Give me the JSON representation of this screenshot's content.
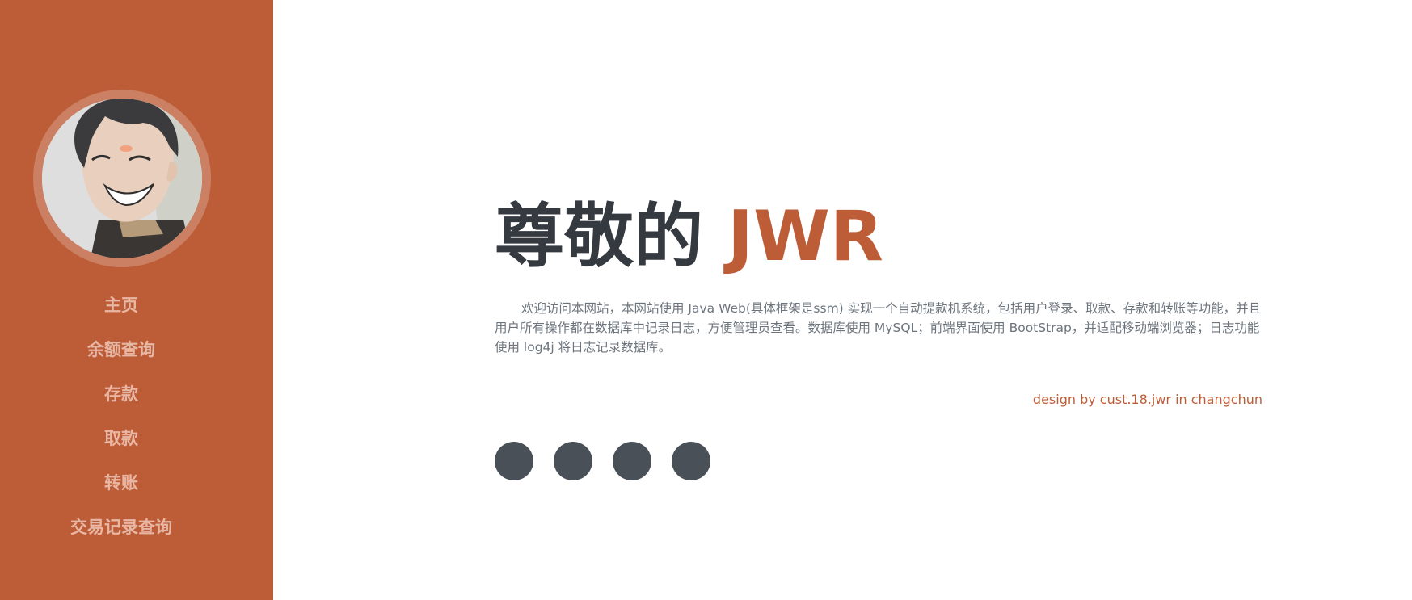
{
  "sidebar": {
    "nav": [
      {
        "label": "主页"
      },
      {
        "label": "余额查询"
      },
      {
        "label": "存款"
      },
      {
        "label": "取款"
      },
      {
        "label": "转账"
      },
      {
        "label": "交易记录查询"
      }
    ]
  },
  "hero": {
    "greeting": "尊敬的",
    "name": "JWR",
    "intro": "欢迎访问本网站，本网站使用 Java Web(具体框架是ssm) 实现一个自动提款机系统，包括用户登录、取款、存款和转账等功能，并且用户所有操作都在数据库中记录日志，方便管理员查看。数据库使用 MySQL；前端界面使用 BootStrap，并适配移动端浏览器；日志功能使用 log4j 将日志记录数据库。",
    "credit": "design by cust.18.jwr in changchun"
  },
  "social_links": [
    {
      "icon": "social-icon-1"
    },
    {
      "icon": "social-icon-2"
    },
    {
      "icon": "social-icon-3"
    },
    {
      "icon": "social-icon-4"
    }
  ],
  "colors": {
    "accent": "#bd5d38",
    "nav_text": "#e8b7a4",
    "heading": "#343a40",
    "body_text": "#6c757d",
    "social_bg": "#495057"
  }
}
